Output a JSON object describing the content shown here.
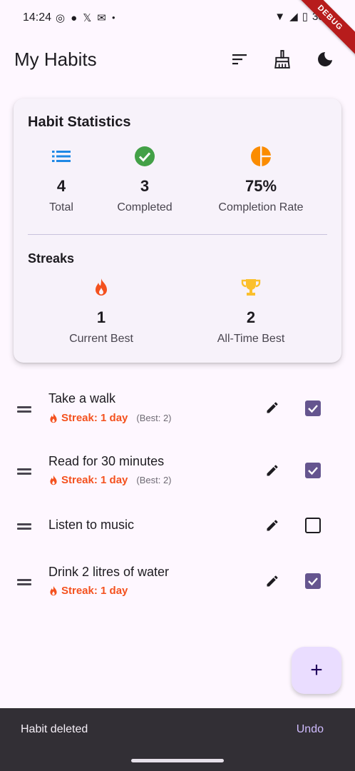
{
  "status_bar": {
    "time": "14:24",
    "battery": "30%",
    "debug_label": "DEBUG"
  },
  "app_bar": {
    "title": "My Habits",
    "actions": [
      "sort-icon",
      "cleaning-brush-icon",
      "dark-mode-icon"
    ]
  },
  "stats": {
    "title": "Habit Statistics",
    "items": [
      {
        "value": "4",
        "label": "Total",
        "icon": "list-icon",
        "color": "#1e88e5"
      },
      {
        "value": "3",
        "label": "Completed",
        "icon": "check-circle-icon",
        "color": "#43a047"
      },
      {
        "value": "75%",
        "label": "Completion Rate",
        "icon": "pie-chart-icon",
        "color": "#fb8c00"
      }
    ],
    "streaks_title": "Streaks",
    "streaks": [
      {
        "value": "1",
        "label": "Current Best",
        "icon": "fire-icon",
        "color": "#f4511e"
      },
      {
        "value": "2",
        "label": "All-Time Best",
        "icon": "trophy-icon",
        "color": "#fbc02d"
      }
    ]
  },
  "habits": [
    {
      "name": "Take a walk",
      "streak": "Streak: 1 day",
      "best": "(Best: 2)",
      "checked": true
    },
    {
      "name": "Read for 30 minutes",
      "streak": "Streak: 1 day",
      "best": "(Best: 2)",
      "checked": true
    },
    {
      "name": "Listen to music",
      "streak": "",
      "best": "",
      "checked": false
    },
    {
      "name": "Drink 2 litres of water",
      "streak": "Streak: 1 day",
      "best": "",
      "checked": true
    }
  ],
  "fab": {
    "label": "+"
  },
  "snackbar": {
    "message": "Habit deleted",
    "action": "Undo"
  },
  "colors": {
    "accent": "#65558f",
    "streak": "#f4511e",
    "background": "#fef7ff"
  }
}
